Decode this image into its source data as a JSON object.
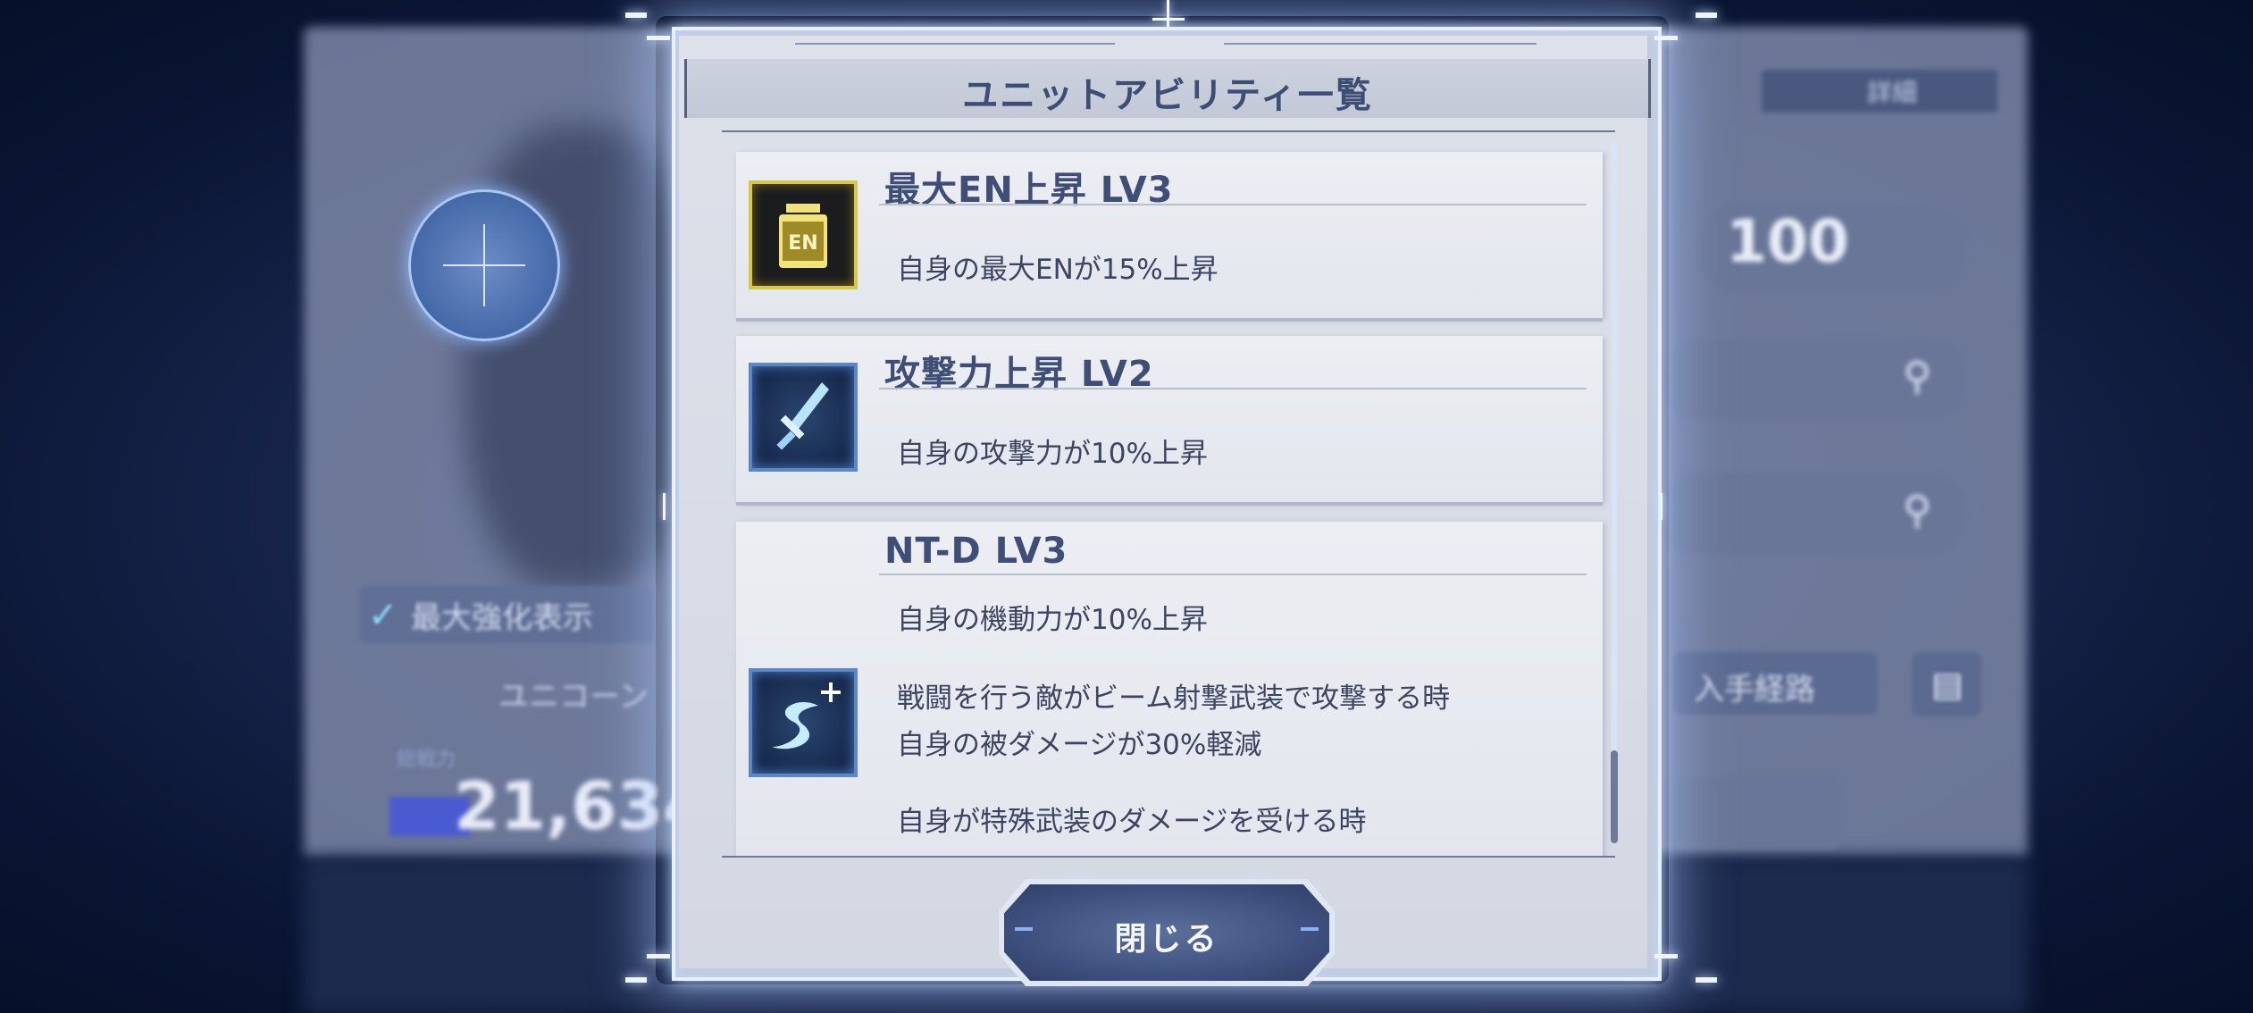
{
  "dialog": {
    "title": "ユニットアビリティ一覧",
    "close_label": "閉じる"
  },
  "abilities": [
    {
      "name": "最大EN上昇 LV3",
      "icon": "en-tank-icon",
      "descriptions": [
        "自身の最大ENが15%上昇"
      ]
    },
    {
      "name": "攻撃力上昇 LV2",
      "icon": "sword-icon",
      "descriptions": [
        "自身の攻撃力が10%上昇"
      ]
    },
    {
      "name": "NT-D LV3",
      "icon": "speed-plus-icon",
      "descriptions": [
        "自身の機動力が10%上昇",
        "戦闘を行う敵がビーム射撃武装で攻撃する時",
        "自身の被ダメージが30%軽減",
        "自身が特殊武装のダメージを受ける時"
      ]
    }
  ],
  "en_icon_text": "EN",
  "background": {
    "max_enhance_label": "最大強化表示",
    "unit_name": "ユニコーン",
    "power_label": "総戦力",
    "power_value": "21,634",
    "level_value": "100",
    "acquire_label": "入手経路",
    "detail_label": "詳細"
  },
  "colors": {
    "title_text": "#3d4d74",
    "card_bg": "#e8eaf0",
    "en_icon_border": "#d8c84a",
    "blue_icon_border": "#5c86c4",
    "close_button": "#3f5180"
  }
}
